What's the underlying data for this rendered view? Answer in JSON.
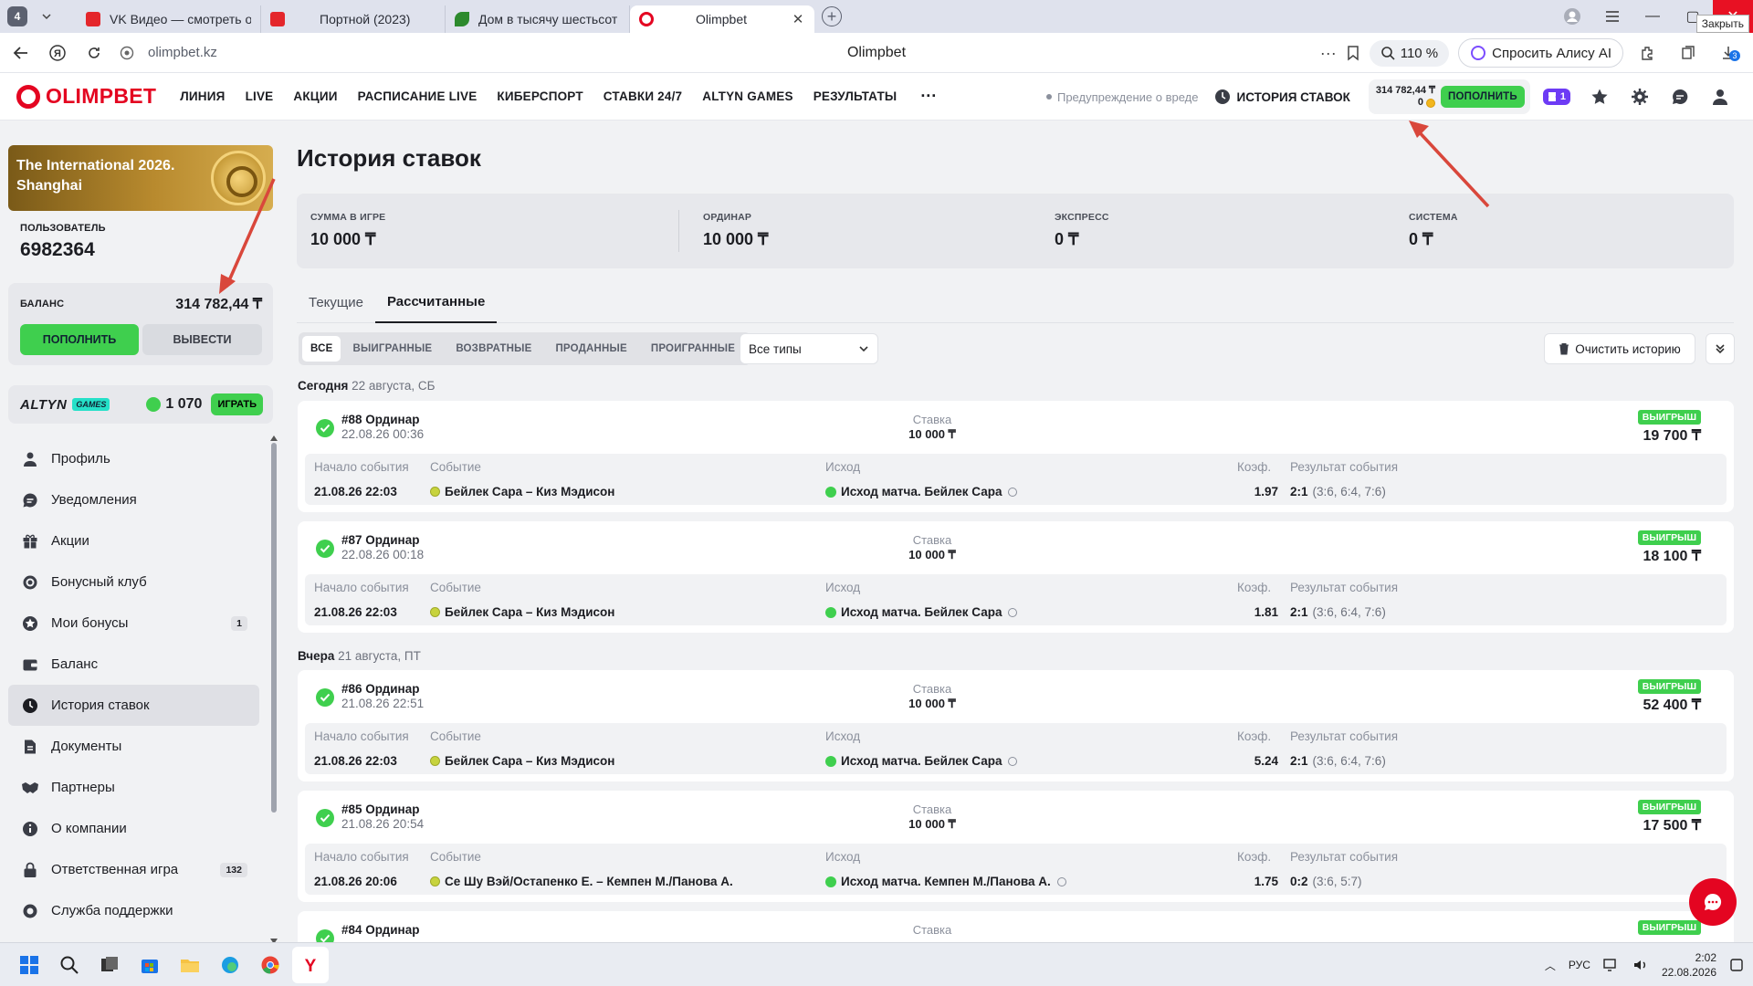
{
  "browser": {
    "tab_count": "4",
    "tabs": [
      {
        "title": "VK Видео — смотреть он",
        "favicon_color": "#e4262b"
      },
      {
        "title": "Портной (2023)",
        "favicon_color": "#e4262b"
      },
      {
        "title": "Дом в тысячу шестьсот э",
        "favicon_color": "#2d8a2d"
      },
      {
        "title": "Olimpbet",
        "favicon_color": "#e40521"
      }
    ],
    "close_tooltip": "Закрыть",
    "url": "olimpbet.kz",
    "page_title": "Olimpbet",
    "zoom": "110 %",
    "alice_label": "Спросить Алису AI",
    "downloads_badge": "3"
  },
  "header": {
    "logo": "OLIMPBET",
    "nav": [
      "ЛИНИЯ",
      "LIVE",
      "АКЦИИ",
      "РАСПИСАНИЕ LIVE",
      "КИБЕРСПОРТ",
      "СТАВКИ 24/7",
      "ALTYN GAMES",
      "РЕЗУЛЬТАТЫ"
    ],
    "more": "···",
    "warning": "Предупреждение о вреде",
    "history_link": "ИСТОРИЯ СТАВОК",
    "balance": "314 782,44 ₸",
    "bonus": "0",
    "deposit": "ПОПОЛНИТЬ",
    "promo_count": "1"
  },
  "sidebar": {
    "banner_title": "The International 2026. Shanghai",
    "user_label": "ПОЛЬЗОВАТЕЛЬ",
    "user_id": "6982364",
    "balance_label": "БАЛАНС",
    "balance_value": "314 782,44 ₸",
    "deposit": "ПОПОЛНИТЬ",
    "withdraw": "ВЫВЕСТИ",
    "altyn_logo": "ALTYN",
    "altyn_games": "GAMES",
    "altyn_points": "1 070",
    "altyn_play": "ИГРАТЬ",
    "menu": [
      {
        "label": "Профиль",
        "icon": "user-icon",
        "count": ""
      },
      {
        "label": "Уведомления",
        "icon": "chat-bubble-icon",
        "count": ""
      },
      {
        "label": "Акции",
        "icon": "gift-icon",
        "count": ""
      },
      {
        "label": "Бонусный клуб",
        "icon": "badge-icon",
        "count": ""
      },
      {
        "label": "Мои бонусы",
        "icon": "star-icon",
        "count": "1"
      },
      {
        "label": "Баланс",
        "icon": "wallet-icon",
        "count": ""
      },
      {
        "label": "История ставок",
        "icon": "clock-icon",
        "count": ""
      },
      {
        "label": "Документы",
        "icon": "document-icon",
        "count": ""
      },
      {
        "label": "Партнеры",
        "icon": "handshake-icon",
        "count": ""
      },
      {
        "label": "О компании",
        "icon": "info-icon",
        "count": ""
      },
      {
        "label": "Ответственная игра",
        "icon": "lock-icon",
        "count": "132"
      },
      {
        "label": "Служба поддержки",
        "icon": "support-icon",
        "count": ""
      }
    ]
  },
  "main": {
    "title": "История ставок",
    "summary": [
      {
        "label": "СУММА В ИГРЕ",
        "value": "10 000 ₸"
      },
      {
        "label": "ОРДИНАР",
        "value": "10 000 ₸"
      },
      {
        "label": "ЭКСПРЕСС",
        "value": "0 ₸"
      },
      {
        "label": "СИСТЕМА",
        "value": "0 ₸"
      }
    ],
    "tabs": [
      "Текущие",
      "Рассчитанные"
    ],
    "filters": [
      "ВСЕ",
      "ВЫИГРАННЫЕ",
      "ВОЗВРАТНЫЕ",
      "ПРОДАННЫЕ",
      "ПРОИГРАННЫЕ"
    ],
    "type_select": "Все типы",
    "clear_history": "Очистить историю",
    "col_labels": {
      "stake": "Ставка",
      "start": "Начало события",
      "event": "Событие",
      "outcome": "Исход",
      "odds": "Коэф.",
      "result": "Результат события",
      "won": "ВЫИГРЫШ"
    },
    "days": [
      {
        "label": "Сегодня",
        "date": "22 августа, СБ"
      },
      {
        "label": "Вчера",
        "date": "21 августа, ПТ"
      }
    ],
    "bets": [
      {
        "title": "#88 Ординар",
        "date": "22.08.26 00:36",
        "stake": "10 000 ₸",
        "win": "19 700 ₸",
        "start": "21.08.26 22:03",
        "event": "Бейлек Сара – Киз Мэдисон",
        "outcome": "Исход матча. Бейлек Сара",
        "odds": "1.97",
        "score": "2:1",
        "sets": "(3:6, 6:4, 7:6)"
      },
      {
        "title": "#87 Ординар",
        "date": "22.08.26 00:18",
        "stake": "10 000 ₸",
        "win": "18 100 ₸",
        "start": "21.08.26 22:03",
        "event": "Бейлек Сара – Киз Мэдисон",
        "outcome": "Исход матча. Бейлек Сара",
        "odds": "1.81",
        "score": "2:1",
        "sets": "(3:6, 6:4, 7:6)"
      },
      {
        "title": "#86 Ординар",
        "date": "21.08.26 22:51",
        "stake": "10 000 ₸",
        "win": "52 400 ₸",
        "start": "21.08.26 22:03",
        "event": "Бейлек Сара – Киз Мэдисон",
        "outcome": "Исход матча. Бейлек Сара",
        "odds": "5.24",
        "score": "2:1",
        "sets": "(3:6, 6:4, 7:6)"
      },
      {
        "title": "#85 Ординар",
        "date": "21.08.26 20:54",
        "stake": "10 000 ₸",
        "win": "17 500 ₸",
        "start": "21.08.26 20:06",
        "event": "Се Шу Вэй/Остапенко Е. – Кемпен М./Панова А.",
        "outcome": "Исход матча. Кемпен М./Панова А.",
        "odds": "1.75",
        "score": "0:2",
        "sets": "(3:6, 5:7)"
      },
      {
        "title": "#84 Ординар",
        "date": "",
        "stake": "",
        "win": "",
        "start": "",
        "event": "",
        "outcome": "",
        "odds": "",
        "score": "",
        "sets": ""
      }
    ]
  },
  "taskbar": {
    "lang": "РУС",
    "time": "2:02",
    "date": "22.08.2026"
  },
  "colors": {
    "brand_red": "#e40521",
    "green": "#3fcf4e",
    "arrow": "#d9473b"
  }
}
